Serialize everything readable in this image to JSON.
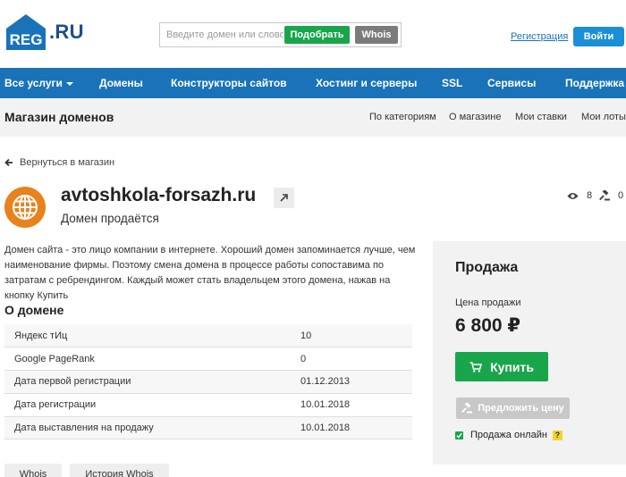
{
  "header": {
    "logo_text": "REG.RU",
    "search_placeholder": "Введите домен или слово",
    "pick_button": "Подобрать",
    "whois_button": "Whois",
    "register_link": "Регистрация",
    "login_button": "Войти"
  },
  "mainnav": {
    "items": [
      {
        "label": "Все услуги"
      },
      {
        "label": "Домены"
      },
      {
        "label": "Конструкторы сайтов"
      },
      {
        "label": "Хостинг и серверы"
      },
      {
        "label": "SSL"
      },
      {
        "label": "Сервисы"
      },
      {
        "label": "Поддержка"
      }
    ]
  },
  "subnav": {
    "title": "Магазин доменов",
    "items": [
      {
        "label": "По категориям"
      },
      {
        "label": "О магазине"
      },
      {
        "label": "Мои ставки"
      },
      {
        "label": "Мои лоты"
      }
    ]
  },
  "back_link": "Вернуться в магазин",
  "domain": {
    "name": "avtoshkola-forsazh.ru",
    "subtitle": "Домен продаётся",
    "views": "8",
    "bids": "0"
  },
  "description": "Домен сайта - это лицо компании в интернете. Хороший домен запоминается лучше, чем наименование фирмы. Поэтому смена домена в процессе работы сопоставима по затратам с ребрендингом. Каждый может стать владельцем этого домена, нажав на кнопку Купить",
  "about": {
    "title": "О домене",
    "rows": [
      {
        "key": "Яндекс тИц",
        "value": "10"
      },
      {
        "key": "Google PageRank",
        "value": "0"
      },
      {
        "key": "Дата первой регистрации",
        "value": "01.12.2013"
      },
      {
        "key": "Дата регистрации",
        "value": "10.01.2018"
      },
      {
        "key": "Дата выставления на продажу",
        "value": "10.01.2018"
      }
    ]
  },
  "bottom_buttons": [
    {
      "label": "Whois"
    },
    {
      "label": "История Whois"
    }
  ],
  "sale": {
    "title": "Продажа",
    "price_label": "Цена продажи",
    "price": "6 800 ₽",
    "buy_button": "Купить",
    "offer_button": "Предложить цену",
    "online_label": "Продажа онлайн",
    "help_mark": "?"
  },
  "colors": {
    "brand_blue": "#1a73b8",
    "green": "#19a64b",
    "orange": "#e8821c"
  }
}
